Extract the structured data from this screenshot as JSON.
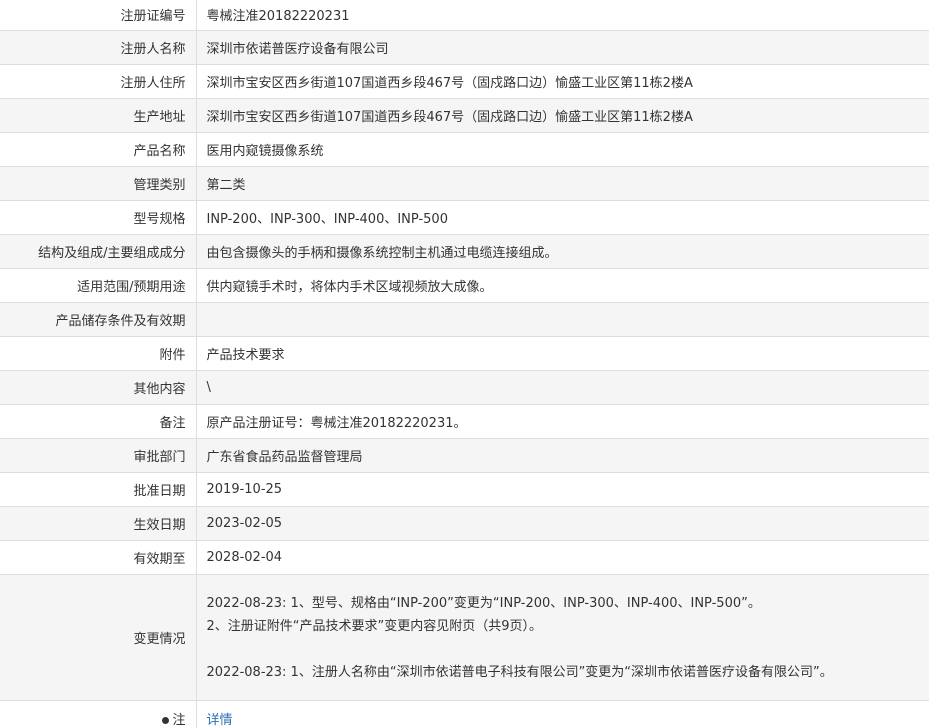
{
  "rows": [
    {
      "label": "注册证编号",
      "value": "粤械注准20182220231"
    },
    {
      "label": "注册人名称",
      "value": "深圳市依诺普医疗设备有限公司"
    },
    {
      "label": "注册人住所",
      "value": "深圳市宝安区西乡街道107国道西乡段467号（固戍路口边）愉盛工业区第11栋2楼A"
    },
    {
      "label": "生产地址",
      "value": "深圳市宝安区西乡街道107国道西乡段467号（固戍路口边）愉盛工业区第11栋2楼A"
    },
    {
      "label": "产品名称",
      "value": "医用内窥镜摄像系统"
    },
    {
      "label": "管理类别",
      "value": "第二类"
    },
    {
      "label": "型号规格",
      "value": "INP-200、INP-300、INP-400、INP-500"
    },
    {
      "label": "结构及组成/主要组成成分",
      "value": "由包含摄像头的手柄和摄像系统控制主机通过电缆连接组成。"
    },
    {
      "label": "适用范围/预期用途",
      "value": "供内窥镜手术时，将体内手术区域视频放大成像。"
    },
    {
      "label": "产品储存条件及有效期",
      "value": ""
    },
    {
      "label": "附件",
      "value": "产品技术要求"
    },
    {
      "label": "其他内容",
      "value": "\\"
    },
    {
      "label": "备注",
      "value": "原产品注册证号：粤械注准20182220231。"
    },
    {
      "label": "审批部门",
      "value": "广东省食品药品监督管理局"
    },
    {
      "label": "批准日期",
      "value": "2019-10-25"
    },
    {
      "label": "生效日期",
      "value": "2023-02-05"
    },
    {
      "label": "有效期至",
      "value": "2028-02-04"
    }
  ],
  "change": {
    "label": "变更情况",
    "line1": "2022-08-23: 1、型号、规格由“INP-200”变更为“INP-200、INP-300、INP-400、INP-500”。",
    "line2": "2、注册证附件“产品技术要求”变更内容见附页（共9页）。",
    "line3": "2022-08-23: 1、注册人名称由“深圳市依诺普电子科技有限公司”变更为“深圳市依诺普医疗设备有限公司”。"
  },
  "last": {
    "label": "注",
    "link": "详情"
  }
}
